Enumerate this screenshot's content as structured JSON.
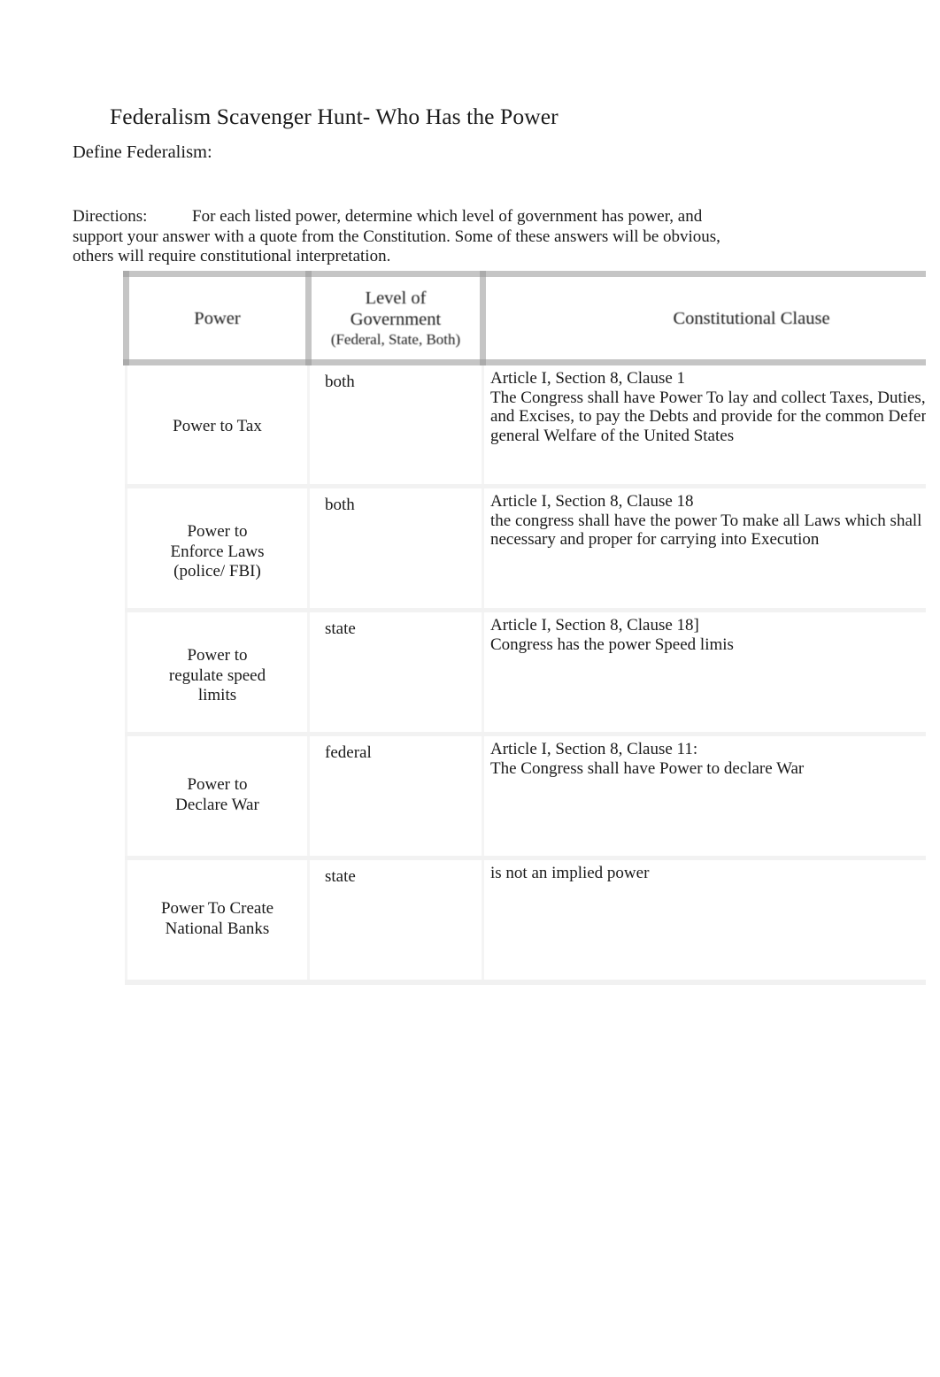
{
  "document": {
    "title": "Federalism Scavenger Hunt- Who Has the Power",
    "define_prompt": "Define Federalism:",
    "directions_label": "Directions:",
    "directions_body": "For each listed power, determine which level of government has power, and support your answer with a quote from the Constitution. Some of these answers will be obvious, others will require constitutional interpretation."
  },
  "table": {
    "headers": {
      "power": "Power",
      "level_line1": "Level of",
      "level_line2": "Government",
      "level_sub": "(Federal, State, Both)",
      "clause": "Constitutional Clause"
    },
    "rows": [
      {
        "power": "Power to Tax",
        "level": "both",
        "clause_lines": [
          "Article I, Section 8, Clause 1",
          "The Congress shall have Power To lay and collect Taxes, Duties, Imposts",
          "and Excises, to pay the Debts and provide for the common Defence and",
          "general Welfare of the United States"
        ]
      },
      {
        "power_lines": [
          "Power to",
          "Enforce Laws",
          "(police/ FBI)"
        ],
        "level": "both",
        "clause_lines": [
          "Article I, Section 8, Clause 18",
          "the congress shall have the power To make all Laws which shall be",
          "necessary and proper for carrying into Execution"
        ]
      },
      {
        "power_lines": [
          "Power to",
          "regulate speed",
          "limits"
        ],
        "level": "state",
        "clause_lines": [
          "Article I, Section 8, Clause 18]",
          "Congress has the power Speed limis"
        ]
      },
      {
        "power_lines": [
          "Power to",
          "Declare War"
        ],
        "level": "federal",
        "clause_lines": [
          "Article I, Section 8, Clause 11:",
          "The Congress shall have Power to declare War"
        ]
      },
      {
        "power_lines": [
          "Power To Create",
          "National Banks"
        ],
        "level": "state",
        "clause_lines": [
          "is not an implied power"
        ]
      }
    ]
  },
  "colors": {
    "page_background": "#ffffff",
    "text": "#1a1a1a",
    "header_border": "#969696",
    "row_separator": "#f2f2f2"
  }
}
